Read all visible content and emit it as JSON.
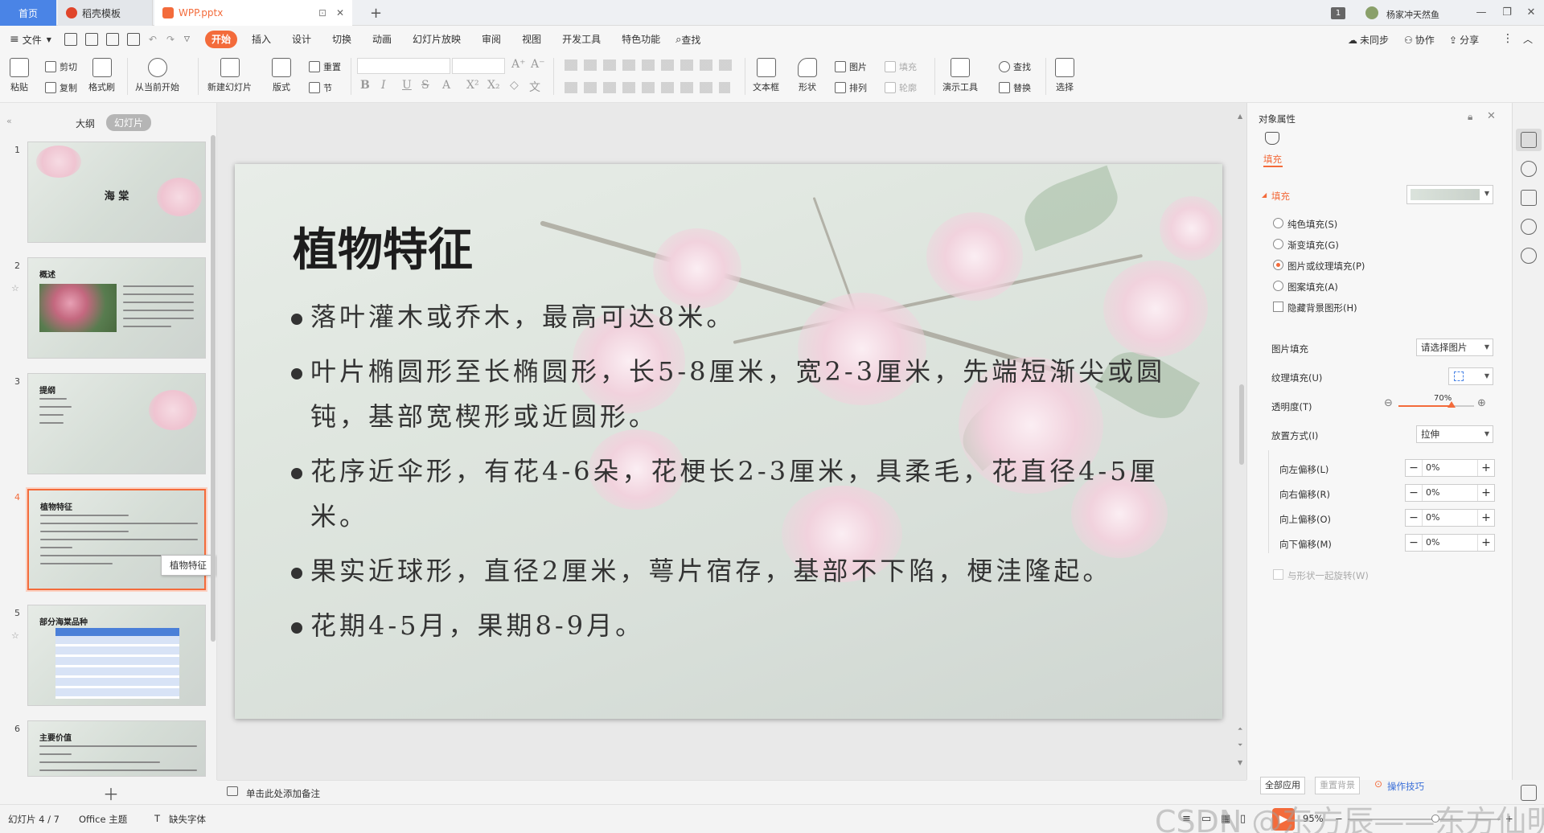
{
  "titlebar": {
    "home_tab": "首页",
    "template_tab": "稻壳模板",
    "doc_tab": "WPP.pptx",
    "new_tab": "+",
    "count_badge": "1",
    "user_name": "杨家冲天然鱼",
    "minimize": "—",
    "maximize": "❐",
    "close": "✕"
  },
  "menubar": {
    "file": "文件",
    "items": [
      "开始",
      "插入",
      "设计",
      "切换",
      "动画",
      "幻灯片放映",
      "审阅",
      "视图",
      "开发工具",
      "特色功能"
    ],
    "search": "查找",
    "sync": "未同步",
    "collab": "协作",
    "share": "分享"
  },
  "ribbon": {
    "paste": "粘贴",
    "cut": "剪切",
    "copy": "复制",
    "format_painter": "格式刷",
    "from_current": "从当前开始",
    "new_slide": "新建幻灯片",
    "layout": "版式",
    "reset": "重置",
    "section": "节",
    "textbox": "文本框",
    "shape": "形状",
    "picture": "图片",
    "arrange": "排列",
    "fill": "填充",
    "outline": "轮廓",
    "present_tools": "演示工具",
    "find": "查找",
    "replace": "替换",
    "select": "选择"
  },
  "left_panel": {
    "outline_tab": "大纲",
    "slides_tab": "幻灯片",
    "tooltip": "植物特征",
    "slides": [
      {
        "num": "1",
        "title": "海 棠"
      },
      {
        "num": "2",
        "title": "概述"
      },
      {
        "num": "3",
        "title": "提纲"
      },
      {
        "num": "4",
        "title": "植物特征"
      },
      {
        "num": "5",
        "title": "部分海棠品种"
      },
      {
        "num": "6",
        "title": "主要价值"
      }
    ]
  },
  "slide": {
    "title": "植物特征",
    "bullets": [
      "落叶灌木或乔木，最高可达8米。",
      "叶片椭圆形至长椭圆形，长5-8厘米，宽2-3厘米，先端短渐尖或圆钝，基部宽楔形或近圆形。",
      "花序近伞形，有花4-6朵，花梗长2-3厘米，具柔毛，花直径4-5厘米。",
      "果实近球形，直径2厘米，萼片宿存，基部不下陷，梗洼隆起。",
      "花期4-5月，果期8-9月。"
    ]
  },
  "right_panel": {
    "title": "对象属性",
    "fill_tab": "填充",
    "fill_section": "填充",
    "options": [
      "纯色填充(S)",
      "渐变填充(G)",
      "图片或纹理填充(P)",
      "图案填充(A)"
    ],
    "hide_bg": "隐藏背景图形(H)",
    "picture_fill_label": "图片填充",
    "picture_fill_value": "请选择图片",
    "texture_fill_label": "纹理填充(U)",
    "transparency_label": "透明度(T)",
    "transparency_value": "70%",
    "transparency_level": 0.7,
    "placement_label": "放置方式(I)",
    "placement_value": "拉伸",
    "offsets": [
      {
        "label": "向左偏移(L)",
        "value": "0%"
      },
      {
        "label": "向右偏移(R)",
        "value": "0%"
      },
      {
        "label": "向上偏移(O)",
        "value": "0%"
      },
      {
        "label": "向下偏移(M)",
        "value": "0%"
      }
    ],
    "rotate_with_shape": "与形状一起旋转(W)",
    "apply_all": "全部应用",
    "reset_bg": "重置背景",
    "tips": "操作技巧"
  },
  "notes": {
    "placeholder": "单击此处添加备注"
  },
  "status": {
    "slide_count": "幻灯片 4 / 7",
    "theme": "Office 主题",
    "missing_font": "缺失字体",
    "zoom": "95%",
    "watermark": "CSDN @东方辰——东方仙明"
  },
  "colors": {
    "accent": "#f36b3b",
    "home_tab": "#4a84e6",
    "link": "#3a6fd8"
  }
}
